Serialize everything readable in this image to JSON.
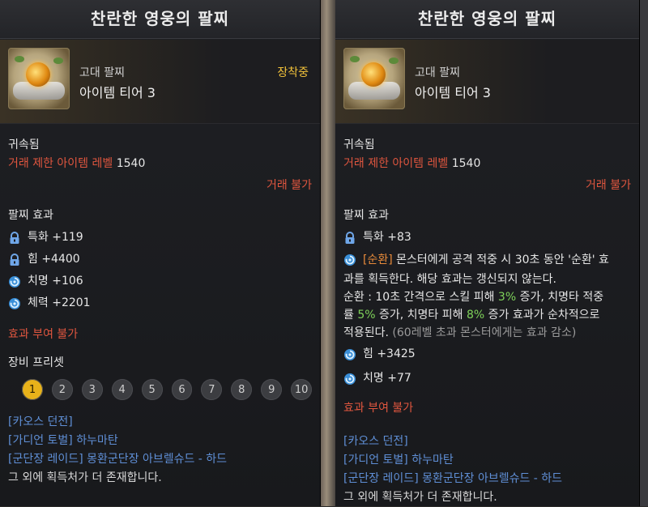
{
  "left": {
    "title": "찬란한 영웅의 팔찌",
    "category": "고대 팔찌",
    "tier": "아이템 티어 3",
    "equipped": "장착중",
    "bound": "귀속됨",
    "trade_level_label": "거래 제한 아이템 레벨",
    "trade_level_value": "1540",
    "trade_status": "거래 불가",
    "effects_header": "팔찌 효과",
    "stats": [
      {
        "icon": "lock-icon",
        "text": "특화 +119"
      },
      {
        "icon": "lock-icon",
        "text": "힘 +4400"
      },
      {
        "icon": "swirl-icon",
        "text": "치명 +106"
      },
      {
        "icon": "swirl-icon",
        "text": "체력 +2201"
      }
    ],
    "no_enchant": "효과 부여 불가",
    "preset_label": "장비 프리셋",
    "presets": [
      "1",
      "2",
      "3",
      "4",
      "5",
      "6",
      "7",
      "8",
      "9",
      "10"
    ],
    "active_preset": "1",
    "sources": [
      {
        "color": "blue",
        "text": "[카오스 던전]"
      },
      {
        "color": "blue",
        "text": "[가디언 토벌] 하누마탄"
      },
      {
        "color": "blue",
        "text": "[군단장 레이드] 몽환군단장 아브렐슈드 - 하드"
      },
      {
        "color": "white",
        "text": "그 외에 획득처가 더 존재합니다."
      }
    ]
  },
  "right": {
    "title": "찬란한 영웅의 팔찌",
    "category": "고대 팔찌",
    "tier": "아이템 티어 3",
    "bound": "귀속됨",
    "trade_level_label": "거래 제한 아이템 레벨",
    "trade_level_value": "1540",
    "trade_status": "거래 불가",
    "effects_header": "팔찌 효과",
    "stat1": {
      "icon": "lock-icon",
      "text": "특화 +83"
    },
    "special": {
      "tag": "[순환]",
      "line1": " 몬스터에게 공격 적중 시 30초 동안 '순환' 효",
      "line2": "과를 획득한다. 해당 효과는 갱신되지 않는다.",
      "line3a": "순환 : 10초 간격으로 스킬 피해 ",
      "pct1": "3%",
      "line3b": " 증가, 치명타 적중",
      "line4a": "률 ",
      "pct2": "5%",
      "line4b": " 증가, 치명타 피해 ",
      "pct3": "8%",
      "line4c": " 증가 효과가 순차적으로",
      "line5a": "적용된다. ",
      "line5b": "(60레벨 초과 몬스터에게는 효과 감소)"
    },
    "stat2": {
      "icon": "swirl-icon",
      "text": "힘 +3425"
    },
    "stat3": {
      "icon": "swirl-icon",
      "text": "치명 +77"
    },
    "no_enchant": "효과 부여 불가",
    "sources": [
      {
        "color": "blue",
        "text": "[카오스 던전]"
      },
      {
        "color": "blue",
        "text": "[가디언 토벌] 하누마탄"
      },
      {
        "color": "blue",
        "text": "[군단장 레이드] 몽환군단장 아브렐슈드 - 하드"
      },
      {
        "color": "white",
        "text": "그 외에 획득처가 더 존재합니다."
      }
    ]
  },
  "colors": {
    "red": "#e0563f",
    "gold": "#f2c23a",
    "green": "#7fd35a",
    "blue": "#5f8fd6"
  }
}
